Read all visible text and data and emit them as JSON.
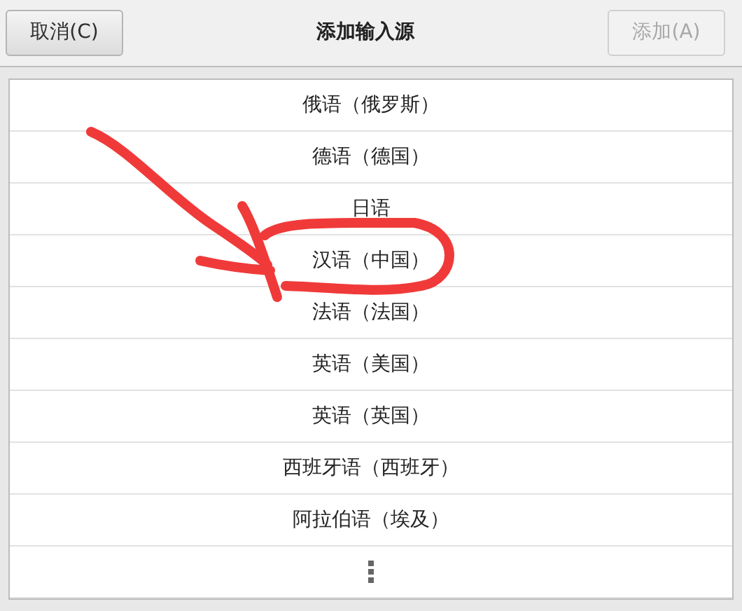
{
  "header": {
    "title": "添加输入源",
    "buttons": [
      {
        "label": "取消(C)",
        "disabled": false
      },
      {
        "label": "添加(A)",
        "disabled": true
      }
    ]
  },
  "languages": [
    "俄语（俄罗斯）",
    "德语（德国）",
    "日语",
    "汉语（中国）",
    "法语（法国）",
    "英语（美国）",
    "英语（英国）",
    "西班牙语（西班牙）",
    "阿拉伯语（埃及）"
  ]
}
